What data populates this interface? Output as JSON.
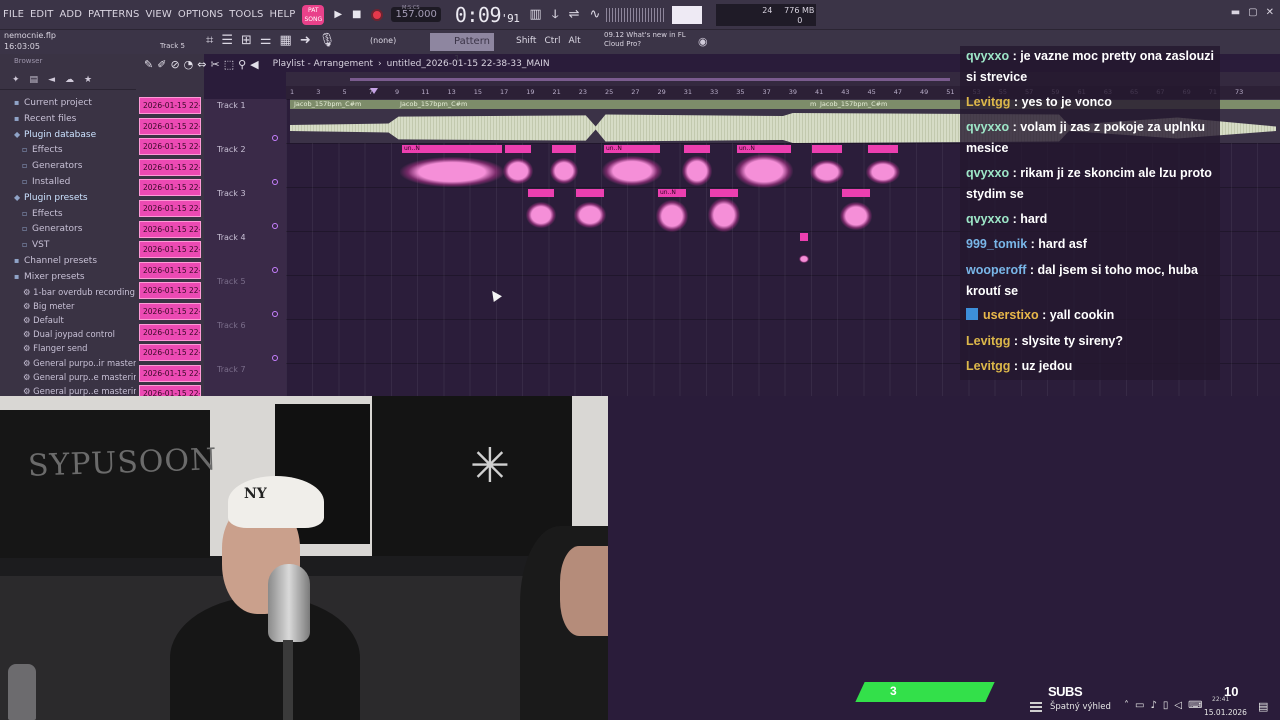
{
  "menu": {
    "items": [
      "FILE",
      "EDIT",
      "ADD",
      "PATTERNS",
      "VIEW",
      "OPTIONS",
      "TOOLS",
      "HELP"
    ],
    "song_label": "SONG",
    "pat_label": "PAT"
  },
  "transport": {
    "play_icon": "play-icon",
    "stop_icon": "stop-icon",
    "record_icon": "record-icon",
    "tempo": "157.000",
    "time_main": "0:09",
    "time_sub": "91",
    "time_label": "M:S:CS",
    "cpu": "24",
    "memory": "776 MB",
    "voices": "0"
  },
  "toolbar2": {
    "file_name": "nemocnie.flp",
    "file_time": "16:03:05",
    "track_hint": "Track 5",
    "snap": "(none)",
    "pattern": "Pattern 1",
    "keys": [
      "Shift",
      "Ctrl",
      "Alt"
    ],
    "news_time": "09.12",
    "news_text": "What's new in FL",
    "news_sub": "Cloud Pro?"
  },
  "browser": {
    "header": "Browser",
    "items": [
      {
        "label": "Current project",
        "level": 0
      },
      {
        "label": "Recent files",
        "level": 0
      },
      {
        "label": "Plugin database",
        "level": 0,
        "highlight": true
      },
      {
        "label": "Effects",
        "level": 1
      },
      {
        "label": "Generators",
        "level": 1
      },
      {
        "label": "Installed",
        "level": 1
      },
      {
        "label": "Plugin presets",
        "level": 0,
        "highlight": true
      },
      {
        "label": "Effects",
        "level": 1
      },
      {
        "label": "Generators",
        "level": 1
      },
      {
        "label": "VST",
        "level": 1
      },
      {
        "label": "Channel presets",
        "level": 0
      },
      {
        "label": "Mixer presets",
        "level": 0
      }
    ],
    "mixer_presets": [
      "1-bar overdub recording",
      "Big meter",
      "Default",
      "Dual joypad control",
      "Flanger send",
      "General purpo..ir mastering",
      "General purp..e mastering 2",
      "General purp..e mastering 3"
    ]
  },
  "clips": [
    "2026-01-15 22-",
    "2026-01-15 22-",
    "2026-01-15 22-",
    "2026-01-15 22-",
    "2026-01-15 22-",
    "2026-01-15 22-",
    "2026-01-15 22-",
    "2026-01-15 22-",
    "2026-01-15 22-",
    "2026-01-15 22-",
    "2026-01-15 22-",
    "2026-01-15 22-",
    "2026-01-15 22-",
    "2026-01-15 22-",
    "2026-01-15 22-"
  ],
  "playlist": {
    "title": "Playlist - Arrangement",
    "project": "untitled_2026-01-15 22-38-33_MAIN",
    "ruler": [
      "1",
      "3",
      "5",
      "7",
      "9",
      "11",
      "13",
      "15",
      "17",
      "19",
      "21",
      "23",
      "25",
      "27",
      "29",
      "31",
      "33",
      "35",
      "37",
      "39",
      "41",
      "43",
      "45",
      "47",
      "49",
      "51",
      "53",
      "55",
      "57",
      "59",
      "61",
      "63",
      "65",
      "67",
      "69",
      "71",
      "73"
    ],
    "tracks": [
      "Track 1",
      "Track 2",
      "Track 3",
      "Track 4",
      "Track 5",
      "Track 6",
      "Track 7"
    ],
    "audio_clip_name": "Jacob_157bpm_C#m",
    "audio_clip_short": "m",
    "clip_label": "un..N"
  },
  "chat": [
    {
      "user": "qvyxxo",
      "color": "#9de6c7",
      "text": "je vazne moc pretty ona zaslouzi si strevice"
    },
    {
      "user": "Levitgg",
      "color": "#ddb84a",
      "text": "yes to je vonco"
    },
    {
      "user": "qvyxxo",
      "color": "#9de6c7",
      "text": "volam ji zas z pokoje za uplnku mesice"
    },
    {
      "user": "qvyxxo",
      "color": "#9de6c7",
      "text": "rikam ji ze skoncim ale lzu proto stydim se"
    },
    {
      "user": "qvyxxo",
      "color": "#9de6c7",
      "text": "hard"
    },
    {
      "user": "999_tomik",
      "color": "#79b6e8",
      "text": "hard asf"
    },
    {
      "user": "wooperoff",
      "color": "#79b6e8",
      "text": "dal jsem si toho moc, huba kroutí se"
    },
    {
      "user": "userstixo",
      "color": "#e8b84a",
      "text": "yall cookin",
      "badge": true
    },
    {
      "user": "Levitgg",
      "color": "#ddb84a",
      "text": "slysite ty sireny?"
    },
    {
      "user": "Levitgg",
      "color": "#ddb84a",
      "text": "uz jedou"
    }
  ],
  "webcam": {
    "poster_text": "SYPUSOON",
    "beanie_logo": "NY"
  },
  "overlay": {
    "subs_count": "3",
    "subs_label": "SUBS",
    "subs_goal": "10",
    "subs_progress": 0.3
  },
  "taskbar": {
    "weather": "Špatný výhled",
    "clock_time": "22:41",
    "date": "15.01.2026"
  }
}
